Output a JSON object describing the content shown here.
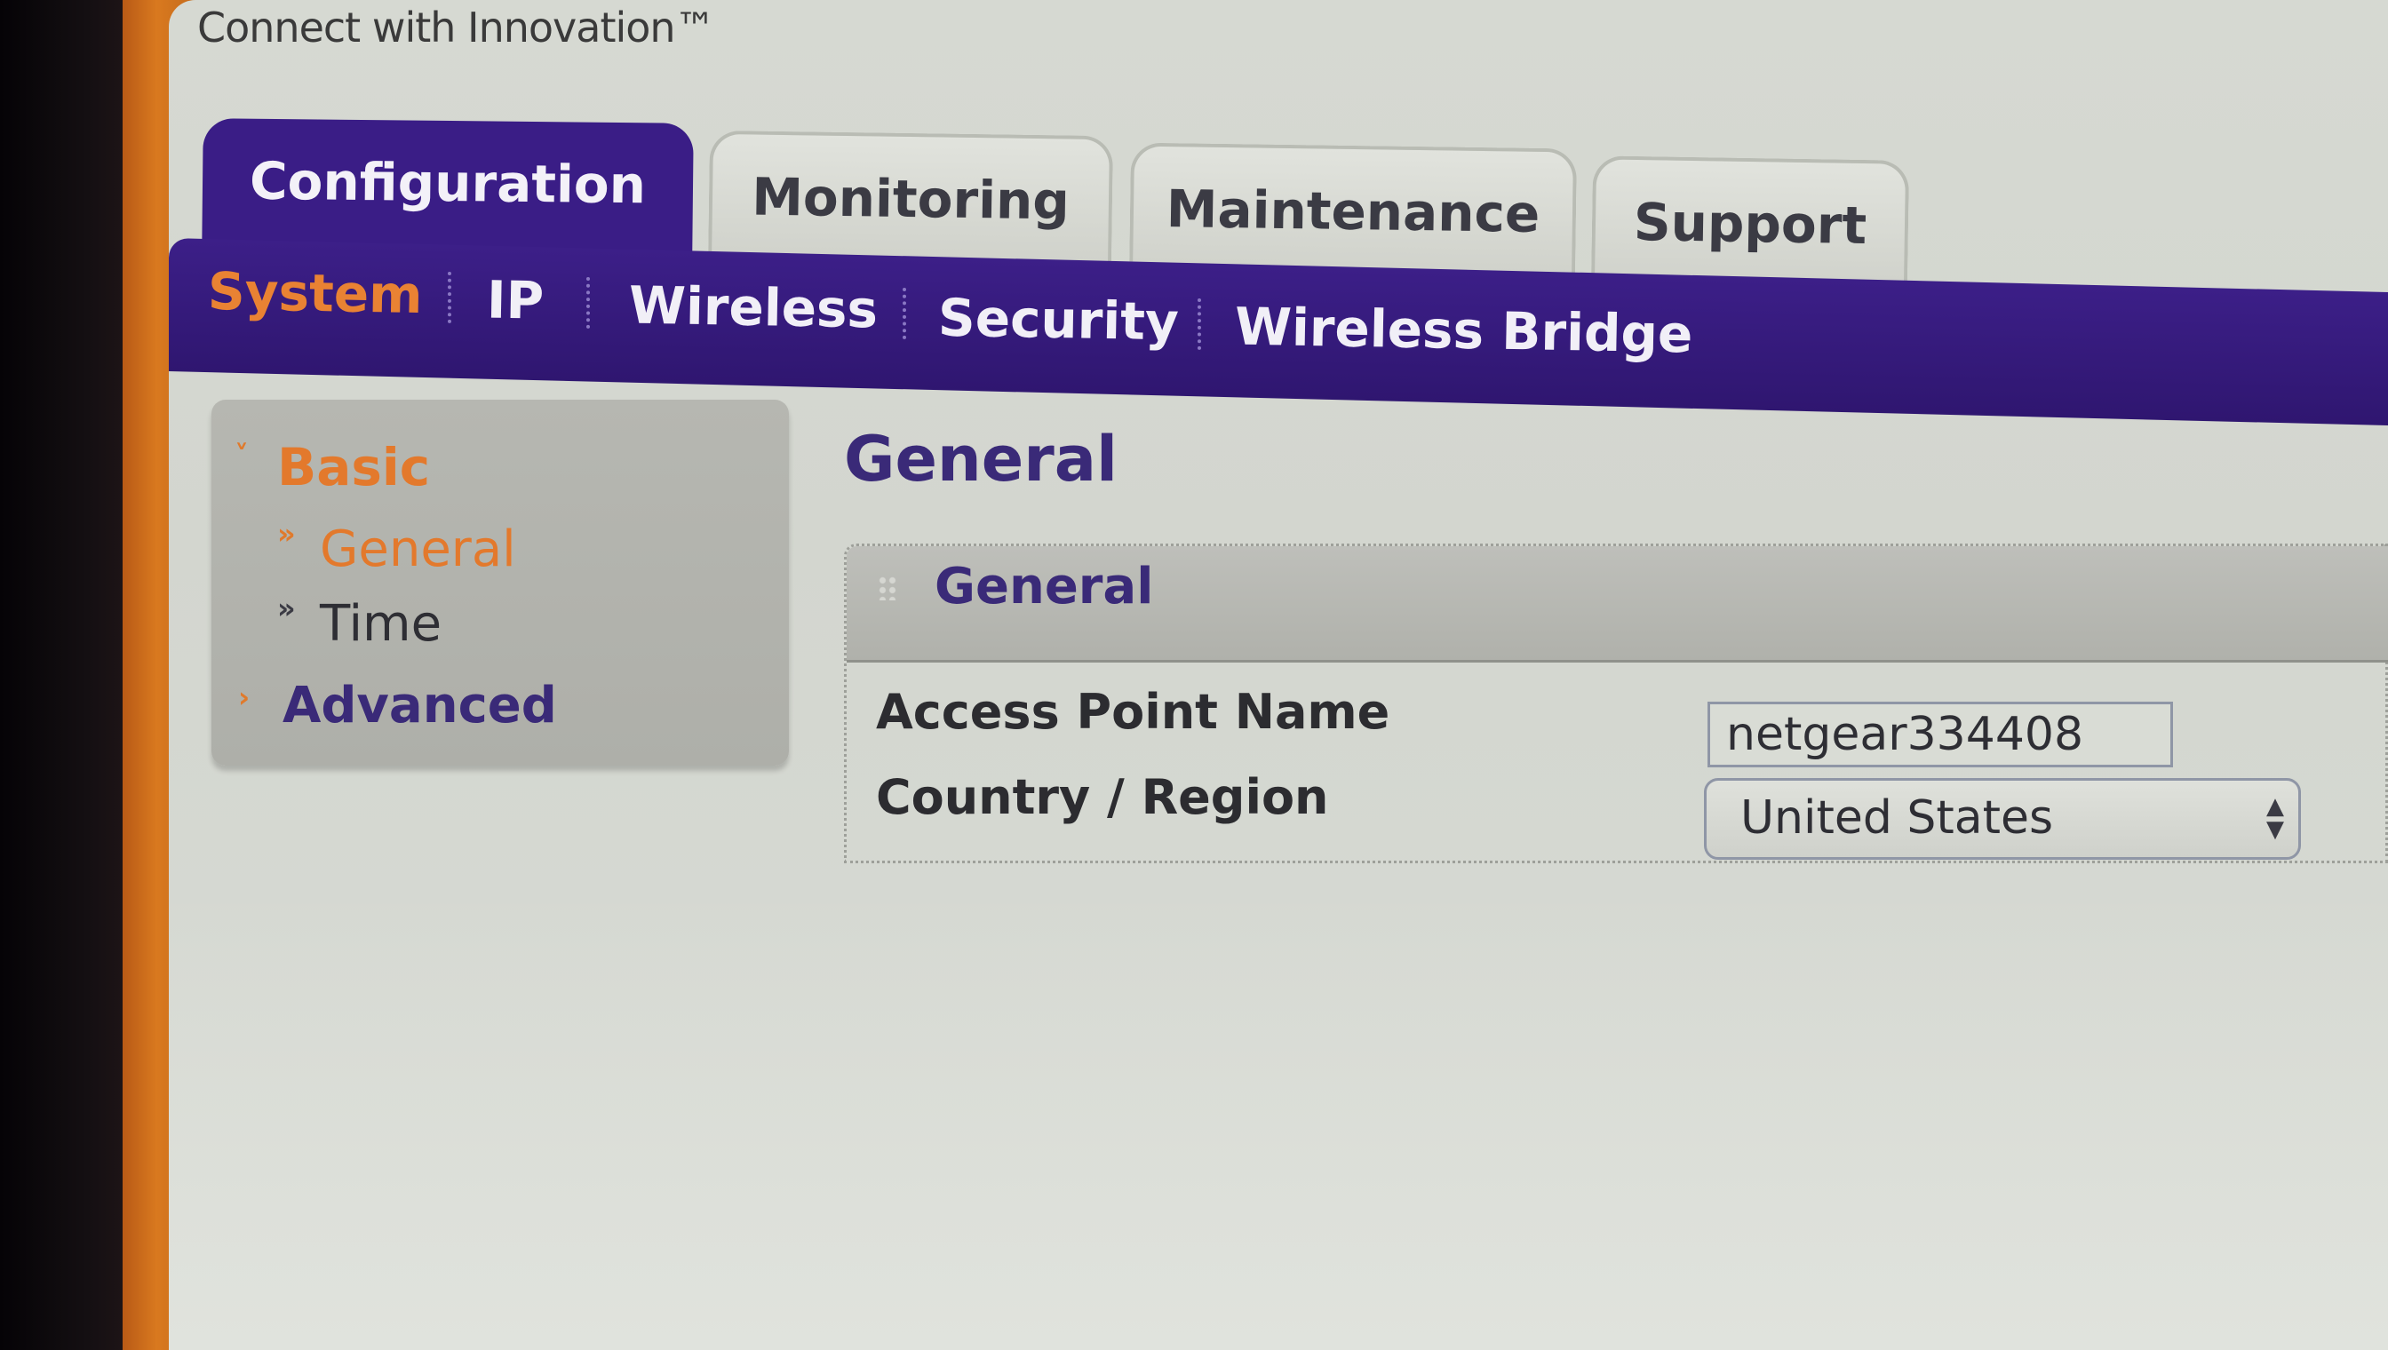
{
  "header": {
    "tagline": "Connect with Innovation™"
  },
  "top_tabs": [
    {
      "label": "Configuration",
      "active": true
    },
    {
      "label": "Monitoring",
      "active": false
    },
    {
      "label": "Maintenance",
      "active": false
    },
    {
      "label": "Support",
      "active": false
    }
  ],
  "subnav": [
    {
      "label": "System",
      "selected": true
    },
    {
      "label": "IP",
      "selected": false
    },
    {
      "label": "Wireless",
      "selected": false
    },
    {
      "label": "Security",
      "selected": false
    },
    {
      "label": "Wireless Bridge",
      "selected": false
    }
  ],
  "sidebar": {
    "groups": [
      {
        "label": "Basic",
        "expanded": true,
        "caret": "˅"
      },
      {
        "label": "Advanced",
        "expanded": false,
        "caret": "›"
      }
    ],
    "items": [
      {
        "label": "General",
        "selected": true,
        "bullet": "»"
      },
      {
        "label": "Time",
        "selected": false,
        "bullet": "»"
      }
    ]
  },
  "main": {
    "page_title": "General",
    "panel": {
      "title": "General",
      "fields": [
        {
          "label": "Access Point Name",
          "value": "netgear334408"
        },
        {
          "label": "Country / Region",
          "value": "United States"
        }
      ]
    }
  },
  "colors": {
    "brand_purple": "#3a1d86",
    "accent_orange": "#e98233",
    "frame_orange": "#d9791f"
  }
}
